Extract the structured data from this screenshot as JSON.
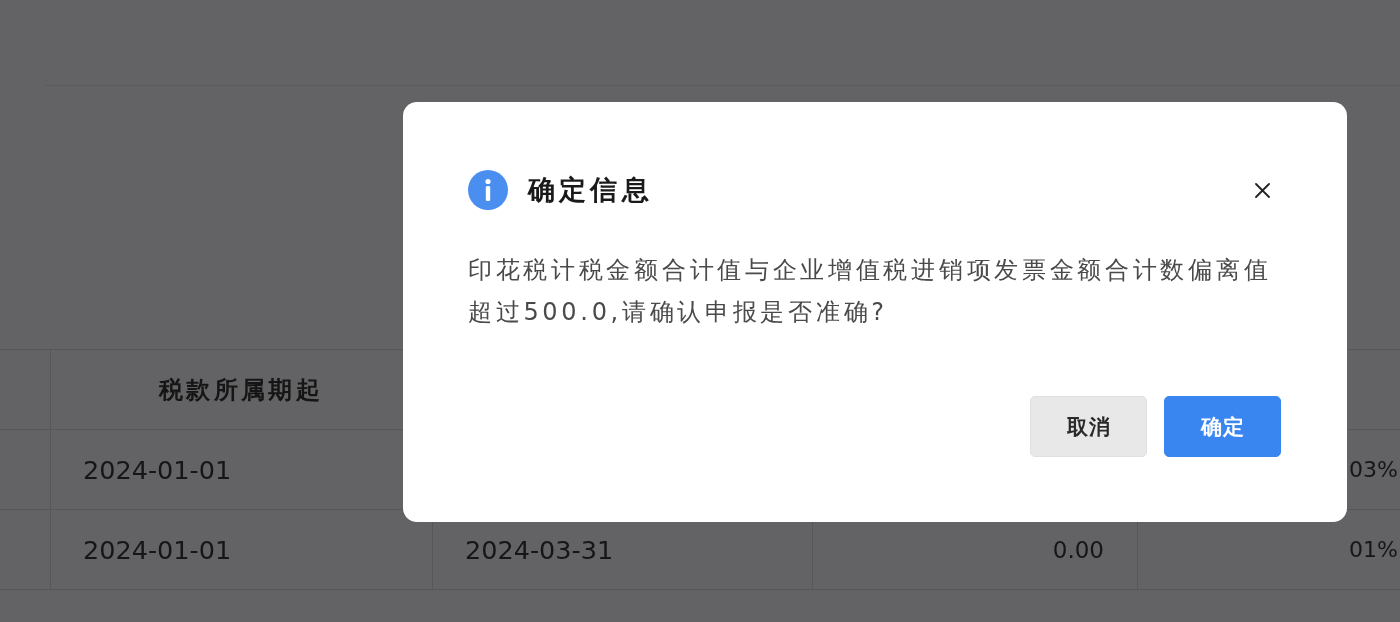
{
  "table": {
    "heading": "税款所属期起",
    "rows": [
      {
        "period_start": "2024-01-01",
        "column_5": "03%"
      },
      {
        "period_start": "2024-01-01",
        "column_3": "2024-03-31",
        "column_4": "0.00",
        "column_5": "01%"
      }
    ]
  },
  "dialog": {
    "title": "确定信息",
    "closable": true,
    "message": "印花税计税金额合计值与企业增值税进销项发票金额合计数偏离值超过500.0,请确认申报是否准确?",
    "buttons": [
      {
        "label": "取消",
        "kind": "secondary"
      },
      {
        "label": "确定",
        "kind": "primary"
      }
    ]
  }
}
